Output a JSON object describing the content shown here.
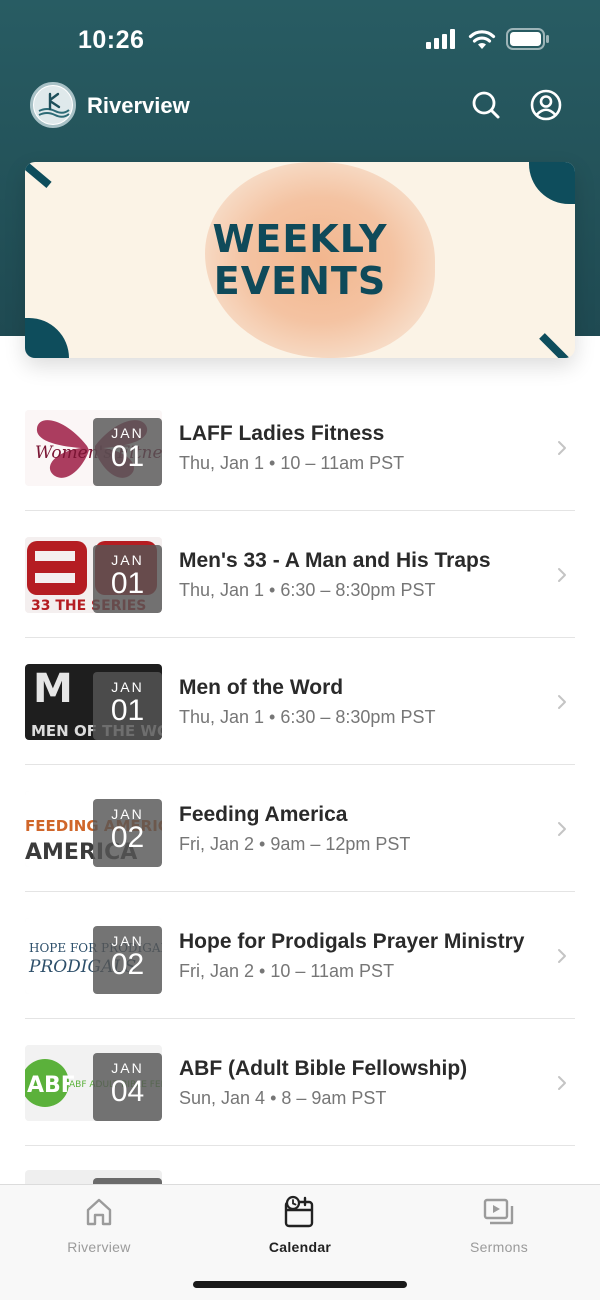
{
  "status_bar": {
    "time": "10:26",
    "icons": [
      "cellular-signal-icon",
      "wifi-icon",
      "battery-icon"
    ]
  },
  "header": {
    "app_name": "Riverview",
    "icons": [
      "search-icon",
      "account-icon"
    ],
    "brand_color": "#245860"
  },
  "banner": {
    "title_line1": "WEEKLY",
    "title_line2": "EVENTS",
    "text_color": "#0f4a5a",
    "background_color": "#fbf3e6"
  },
  "events": [
    {
      "title": "LAFF Ladies Fitness",
      "subtitle": "Thu, Jan 1 • 10 – 11am PST",
      "month": "JAN",
      "day": "01",
      "thumb_text": "Women's Fitness"
    },
    {
      "title": "Men's 33 - A Man and His Traps",
      "subtitle": "Thu, Jan 1 • 6:30 – 8:30pm PST",
      "month": "JAN",
      "day": "01",
      "thumb_text": "33 THE SERIES"
    },
    {
      "title": "Men of the Word",
      "subtitle": "Thu, Jan 1 • 6:30 – 8:30pm PST",
      "month": "JAN",
      "day": "01",
      "thumb_text": "MEN OF THE WORD"
    },
    {
      "title": "Feeding America",
      "subtitle": "Fri, Jan 2 • 9am – 12pm PST",
      "month": "JAN",
      "day": "02",
      "thumb_text": "FEEDING AMERICA"
    },
    {
      "title": "Hope for Prodigals Prayer Ministry",
      "subtitle": "Fri, Jan 2 • 10 – 11am PST",
      "month": "JAN",
      "day": "02",
      "thumb_text": "HOPE FOR PRODIGALS"
    },
    {
      "title": "ABF (Adult Bible Fellowship)",
      "subtitle": "Sun, Jan 4 • 8 – 9am PST",
      "month": "JAN",
      "day": "04",
      "thumb_text": "ABF ADULT BIBLE FELLOWSHIP"
    }
  ],
  "tab_bar": {
    "tabs": [
      {
        "label": "Riverview",
        "icon": "home-icon",
        "active": false
      },
      {
        "label": "Calendar",
        "icon": "calendar-icon",
        "active": true
      },
      {
        "label": "Sermons",
        "icon": "media-playlist-icon",
        "active": false
      }
    ]
  }
}
